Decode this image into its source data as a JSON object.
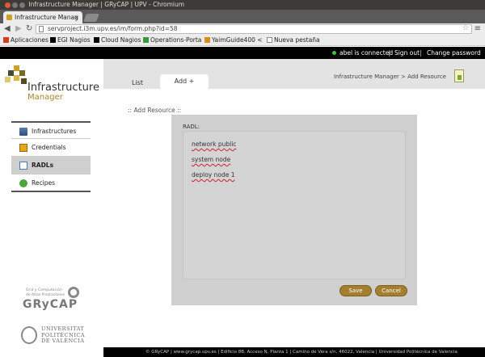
{
  "window": {
    "title": "Infrastructure Manager | GRyCAP | UPV - Chromium"
  },
  "browser": {
    "tab_title": "Infrastructure Manag",
    "url": "servproject.i3m.upv.es/im/form.php?id=58",
    "bookmarks": [
      {
        "label": "Aplicaciones",
        "icon": "apps-grid-icon",
        "color": "#d04020"
      },
      {
        "label": "EGI Nagios",
        "icon": "nagios-icon",
        "color": "#000000"
      },
      {
        "label": "Cloud Nagios",
        "icon": "nagios-icon",
        "color": "#000000"
      },
      {
        "label": "Operations-Porta",
        "icon": "portal-icon",
        "color": "#3a9a3a"
      },
      {
        "label": "YaimGuide400 <",
        "icon": "yaim-icon",
        "color": "#e08a1a"
      },
      {
        "label": "Nueva pestaña",
        "icon": "page-icon",
        "color": "#888888"
      }
    ]
  },
  "app_topbar": {
    "status": "abel is connected",
    "sign_out": "Sign out",
    "change_password": "Change password",
    "status_color": "#3fc43a"
  },
  "brand": {
    "title": "Infrastructure",
    "subtitle": "Manager",
    "accent": "#a8862f"
  },
  "nav": {
    "items": [
      {
        "label": "Infrastructures",
        "icon": "servers-icon",
        "active": false
      },
      {
        "label": "Credentials",
        "icon": "credentials-icon",
        "active": false
      },
      {
        "label": "RADLs",
        "icon": "radl-icon",
        "active": true
      },
      {
        "label": "Recipes",
        "icon": "recipes-icon",
        "active": false
      }
    ]
  },
  "sponsors": {
    "grycap_small": "Grid y Computación\nde Altas Prestaciones",
    "grycap_big": "GRyCAP",
    "upv_lines": [
      "UNIVERSITAT",
      "POLITÈCNICA",
      "DE VALÈNCIA"
    ]
  },
  "content": {
    "tabs": [
      {
        "label": "List",
        "active": false
      },
      {
        "label": "Add +",
        "active": true
      }
    ],
    "breadcrumb": "Infrastructure Manager > Add Resource",
    "panel_title": ":: Add Resource ::",
    "form": {
      "field_label": "RADL:",
      "radl_lines": [
        "network public",
        "system node",
        "deploy node 1"
      ],
      "save_label": "Save",
      "cancel_label": "Cancel",
      "button_color": "#a57f2f"
    }
  },
  "footer": {
    "text": "© GRyCAP  |  www.grycap.upv.es  |  Edificio 8B, Acceso N, Planta 1  |  Camino de Vera s/n, 46022, Valencia  |  Universidad Politécnica de Valencia"
  }
}
